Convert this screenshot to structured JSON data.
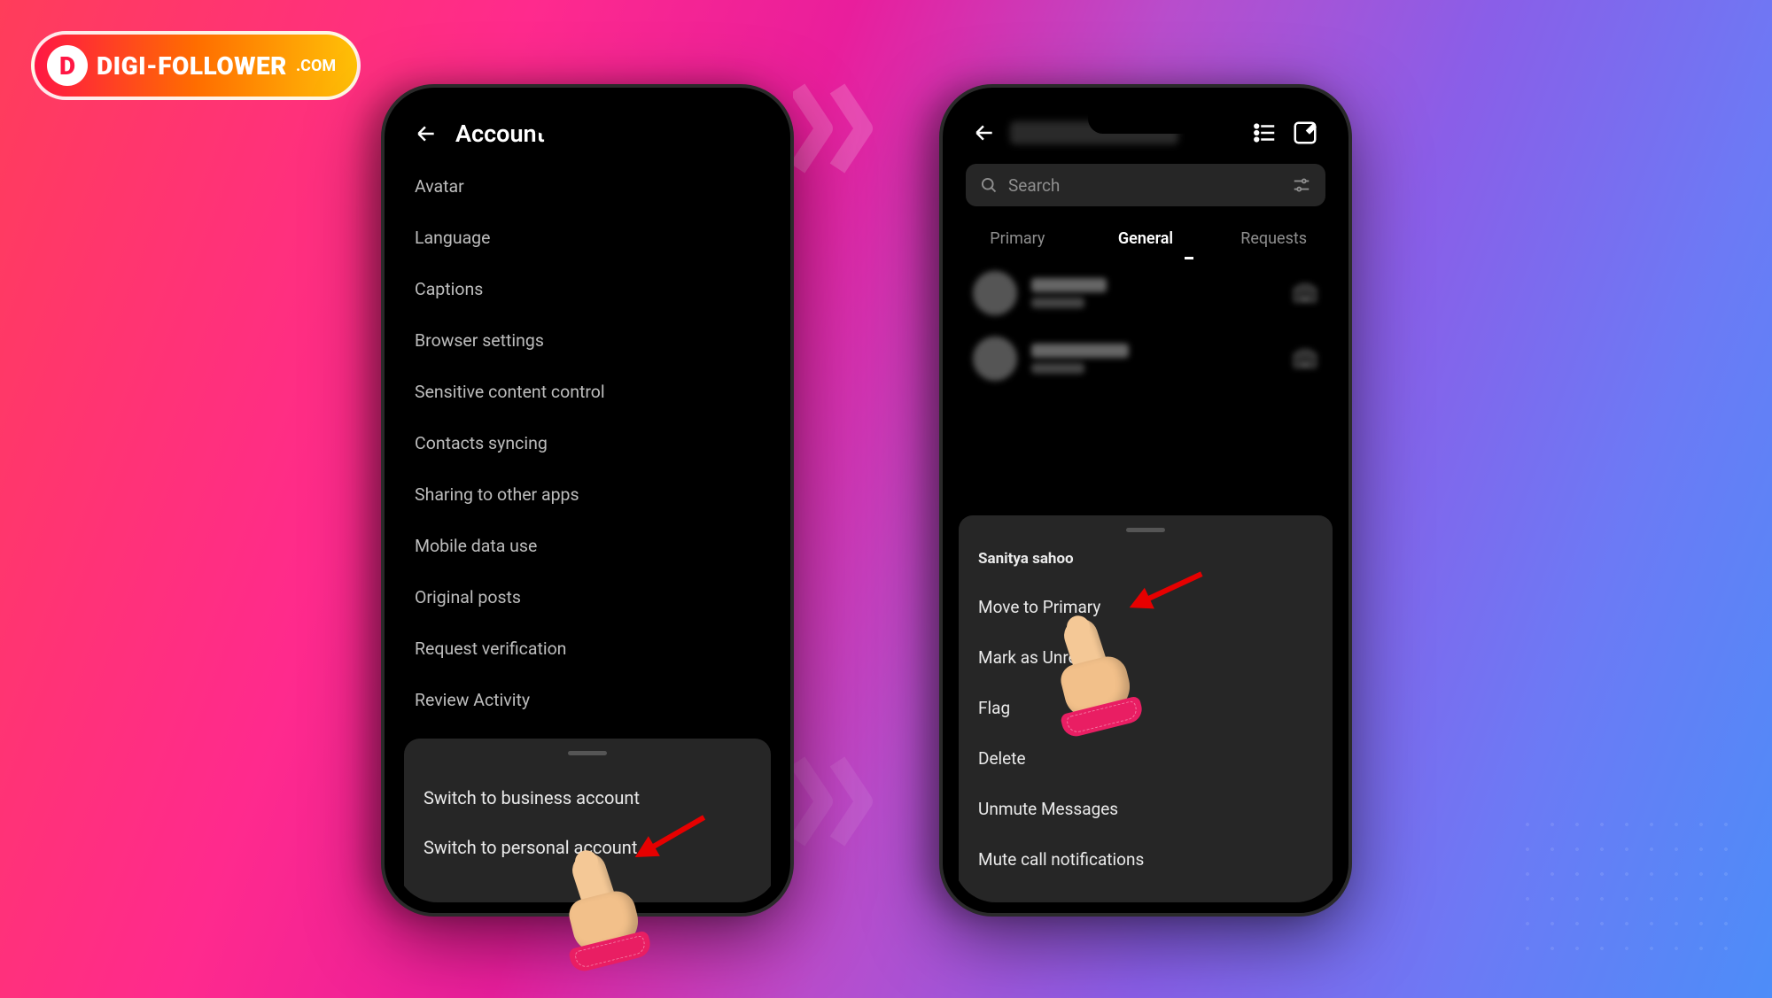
{
  "logo": {
    "letter": "D",
    "main": "DIGI-FOLLOWER",
    "sub": ".COM"
  },
  "phoneLeft": {
    "title": "Account",
    "items": [
      "Avatar",
      "Language",
      "Captions",
      "Browser settings",
      "Sensitive content control",
      "Contacts syncing",
      "Sharing to other apps",
      "Mobile data use",
      "Original posts",
      "Request verification",
      "Review Activity"
    ],
    "sheet": {
      "opt1": "Switch to business account",
      "opt2": "Switch to personal account"
    }
  },
  "phoneRight": {
    "search": "Search",
    "tabs": {
      "t1": "Primary",
      "t2": "General",
      "t3": "Requests"
    },
    "sheet": {
      "name": "Sanitya sahoo",
      "opts": [
        "Move to Primary",
        "Mark as Unread",
        "Flag",
        "Delete",
        "Unmute Messages",
        "Mute call notifications"
      ]
    }
  }
}
